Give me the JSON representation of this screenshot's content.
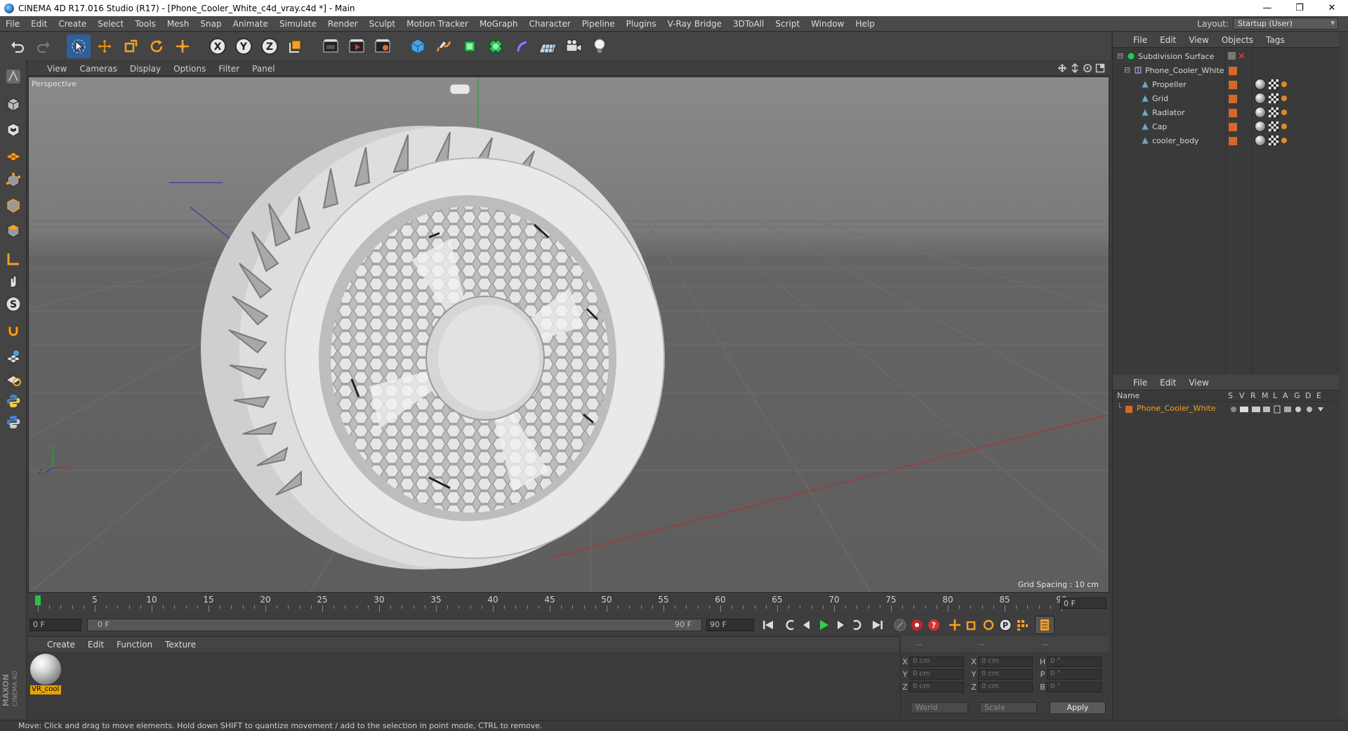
{
  "window": {
    "title": "CINEMA 4D R17.016 Studio (R17) - [Phone_Cooler_White_c4d_vray.c4d *] - Main",
    "controls": [
      "—",
      "❐",
      "✕"
    ]
  },
  "menubar": {
    "items": [
      "File",
      "Edit",
      "Create",
      "Select",
      "Tools",
      "Mesh",
      "Snap",
      "Animate",
      "Simulate",
      "Render",
      "Sculpt",
      "Motion Tracker",
      "MoGraph",
      "Character",
      "Pipeline",
      "Plugins",
      "V-Ray Bridge",
      "3DToAll",
      "Script",
      "Window",
      "Help"
    ],
    "layout_label": "Layout:",
    "layout_value": "Startup (User)"
  },
  "viewport": {
    "menu": [
      "View",
      "Cameras",
      "Display",
      "Options",
      "Filter",
      "Panel"
    ],
    "camera_label": "Perspective",
    "grid_spacing": "Grid Spacing : 10 cm"
  },
  "timeline": {
    "ticks": [
      "0",
      "5",
      "10",
      "15",
      "20",
      "25",
      "30",
      "35",
      "40",
      "45",
      "50",
      "55",
      "60",
      "65",
      "70",
      "75",
      "80",
      "85",
      "90"
    ],
    "current_frame": "0 F",
    "start_field": "0 F",
    "range_start": "0 F",
    "range_end": "90 F",
    "end_field": "90 F"
  },
  "material_manager": {
    "menu": [
      "Create",
      "Edit",
      "Function",
      "Texture"
    ],
    "materials": [
      {
        "name": "VR_cool"
      }
    ]
  },
  "coordinates": {
    "header": [
      "--",
      "--",
      "--"
    ],
    "rows": [
      {
        "a": "X",
        "av": "0 cm",
        "b": "X",
        "bv": "0 cm",
        "c": "H",
        "cv": "0 °"
      },
      {
        "a": "Y",
        "av": "0 cm",
        "b": "Y",
        "bv": "0 cm",
        "c": "P",
        "cv": "0 °"
      },
      {
        "a": "Z",
        "av": "0 cm",
        "b": "Z",
        "bv": "0 cm",
        "c": "B",
        "cv": "0 °"
      }
    ],
    "space": "World",
    "mode": "Scale",
    "apply": "Apply"
  },
  "object_manager": {
    "menu": [
      "File",
      "Edit",
      "View",
      "Objects",
      "Tags"
    ],
    "objects": [
      {
        "name": "Subdivision Surface",
        "depth": 0
      },
      {
        "name": "Phone_Cooler_White",
        "depth": 1
      },
      {
        "name": "Propeller",
        "depth": 2
      },
      {
        "name": "Grid",
        "depth": 2
      },
      {
        "name": "Radiator",
        "depth": 2
      },
      {
        "name": "Cap",
        "depth": 2
      },
      {
        "name": "cooler_body",
        "depth": 2
      }
    ]
  },
  "layer_manager": {
    "menu": [
      "File",
      "Edit",
      "View"
    ],
    "columns": [
      "Name",
      "S",
      "V",
      "R",
      "M",
      "L",
      "A",
      "G",
      "D",
      "E"
    ],
    "layers": [
      {
        "name": "Phone_Cooler_White"
      }
    ]
  },
  "status": {
    "text": "Move: Click and drag to move elements. Hold down SHIFT to quantize movement / add to the selection in point mode, CTRL to remove."
  },
  "colors": {
    "accent": "#2f5f9a",
    "layer_orange": "#d4682a",
    "material_label": "#e8a200",
    "timeline_cursor": "#27c24a"
  }
}
